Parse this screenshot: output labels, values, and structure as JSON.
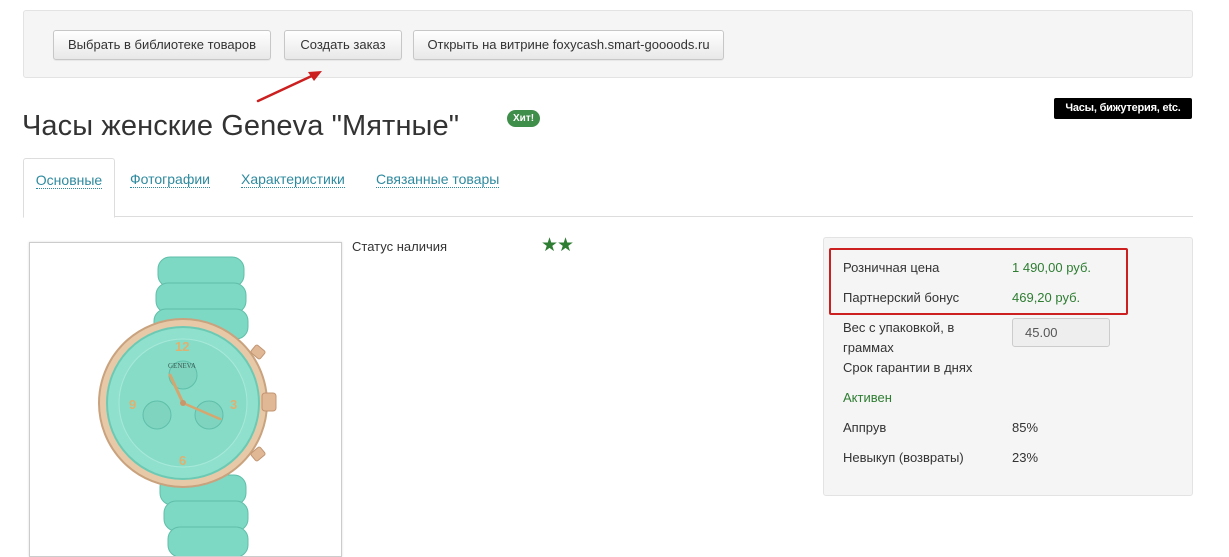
{
  "toolbar": {
    "library_button": "Выбрать в библиотеке товаров",
    "order_button": "Создать заказ",
    "showcase_button": "Открыть на витрине foxycash.smart-goooods.ru"
  },
  "product": {
    "title": "Часы женские Geneva \"Мятные\"",
    "badge": "Хит!",
    "category": "Часы, бижутерия, etc."
  },
  "tabs": [
    "Основные",
    "Фотографии",
    "Характеристики",
    "Связанные товары"
  ],
  "availability": {
    "label": "Статус наличия",
    "stars": "★★"
  },
  "info": {
    "retail_price_label": "Розничная цена",
    "retail_price_value": "1 490,00 руб.",
    "partner_bonus_label": "Партнерский бонус",
    "partner_bonus_value": "469,20 руб.",
    "weight_label": "Вес с упаковкой, в граммах",
    "weight_value": "45.00",
    "warranty_label": "Срок гарантии в днях",
    "active_label": "Активен",
    "approval_label": "Аппрув",
    "approval_value": "85%",
    "nonpurchase_label": "Невыкуп (возвраты)",
    "nonpurchase_value": "23%"
  },
  "watch_face": {
    "brand": "GENEVA",
    "numerals": [
      "12",
      "3",
      "6",
      "9"
    ]
  },
  "colors": {
    "accent_link": "#2e8a9f",
    "price_green": "#2e7d32",
    "highlight_red": "#cc1f1f",
    "watch_mint": "#7dd8c4"
  }
}
